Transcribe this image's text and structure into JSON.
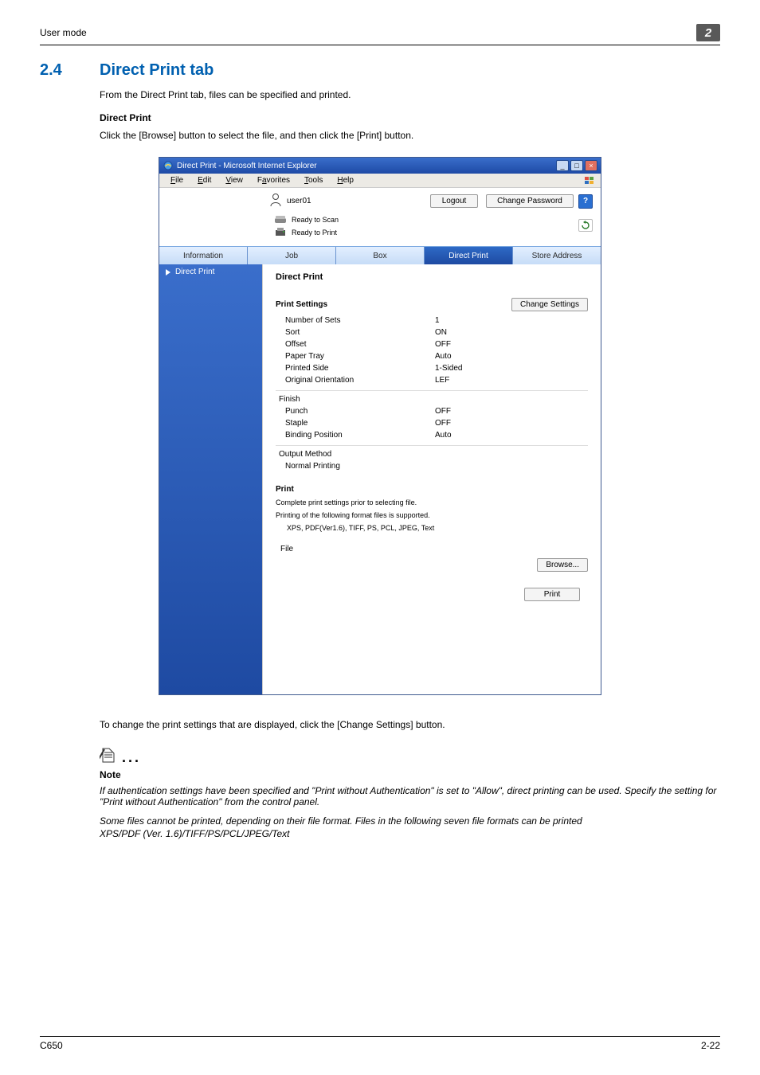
{
  "page_header": {
    "title": "User mode",
    "chapter": "2"
  },
  "section": {
    "number": "2.4",
    "title": "Direct Print tab",
    "intro": "From the Direct Print tab, files can be specified and printed.",
    "sub_head": "Direct Print",
    "sub_text": "Click the [Browse] button to select the file, and then click the [Print] button."
  },
  "window": {
    "title": "Direct Print - Microsoft Internet Explorer",
    "menus": {
      "file": "File",
      "edit": "Edit",
      "view": "View",
      "favorites": "Favorites",
      "tools": "Tools",
      "help": "Help"
    }
  },
  "app": {
    "user": "user01",
    "logout": "Logout",
    "change_password": "Change Password",
    "help": "?",
    "status_scan": "Ready to Scan",
    "status_print": "Ready to Print",
    "tabs": {
      "info": "Information",
      "job": "Job",
      "box": "Box",
      "direct_print": "Direct Print",
      "store_addr": "Store Address"
    },
    "side_item": "Direct Print",
    "main_title": "Direct Print",
    "settings_head": "Print Settings",
    "change_settings": "Change Settings",
    "settings": {
      "num_sets_k": "Number of Sets",
      "num_sets_v": "1",
      "sort_k": "Sort",
      "sort_v": "ON",
      "offset_k": "Offset",
      "offset_v": "OFF",
      "tray_k": "Paper Tray",
      "tray_v": "Auto",
      "side_k": "Printed Side",
      "side_v": "1-Sided",
      "orient_k": "Original Orientation",
      "orient_v": "LEF"
    },
    "finish_head": "Finish",
    "finish": {
      "punch_k": "Punch",
      "punch_v": "OFF",
      "staple_k": "Staple",
      "staple_v": "OFF",
      "bind_k": "Binding Position",
      "bind_v": "Auto"
    },
    "outmethod_head": "Output Method",
    "outmethod_val": "Normal Printing",
    "print_head": "Print",
    "print_msg1": "Complete print settings prior to selecting file.",
    "print_msg2": "Printing of the following format files is supported.",
    "print_msg3": "XPS, PDF(Ver1.6), TIFF, PS, PCL, JPEG, Text",
    "file_label": "File",
    "browse": "Browse...",
    "print_btn": "Print"
  },
  "below": "To change the print settings that are displayed, click the [Change Settings] button.",
  "note": {
    "title": "Note",
    "line1": "If authentication settings have been specified and \"Print without Authentication\" is set to \"Allow\", direct printing can be used. Specify the setting for \"Print without Authentication\" from the control panel.",
    "line2": "Some files cannot be printed, depending on their file format. Files in the following seven file formats can be printed",
    "line3": "XPS/PDF (Ver. 1.6)/TIFF/PS/PCL/JPEG/Text"
  },
  "footer": {
    "left": "C650",
    "right": "2-22"
  }
}
